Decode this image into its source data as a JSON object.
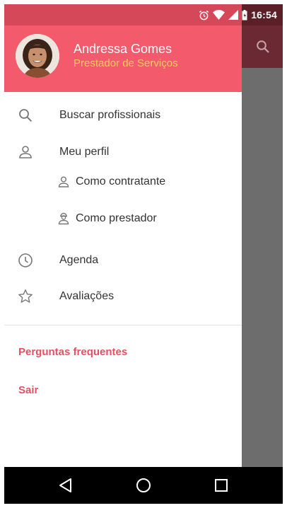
{
  "status_bar": {
    "time": "16:54"
  },
  "profile": {
    "name": "Andressa Gomes",
    "role": "Prestador de Serviços"
  },
  "menu": {
    "items": [
      {
        "label": "Buscar profissionais",
        "icon": "search-icon"
      },
      {
        "label": "Meu perfil",
        "icon": "person-icon"
      },
      {
        "label": "Como contratante",
        "icon": "person-outline-icon"
      },
      {
        "label": "Como prestador",
        "icon": "worker-icon"
      },
      {
        "label": "Agenda",
        "icon": "clock-icon"
      },
      {
        "label": "Avaliações",
        "icon": "star-icon"
      }
    ],
    "links": [
      {
        "label": "Perguntas frequentes"
      },
      {
        "label": "Sair"
      }
    ]
  },
  "colors": {
    "header": "#f35a6b",
    "role_text": "#ffcc61",
    "link": "#e94e62"
  }
}
